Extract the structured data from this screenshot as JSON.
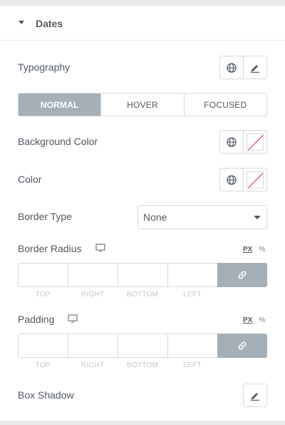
{
  "section": {
    "title": "Dates"
  },
  "typography": {
    "label": "Typography",
    "icons": [
      "globe-icon",
      "pencil-icon"
    ]
  },
  "state_tabs": [
    {
      "label": "NORMAL",
      "active": true
    },
    {
      "label": "HOVER",
      "active": false
    },
    {
      "label": "FOCUSED",
      "active": false
    }
  ],
  "background_color": {
    "label": "Background Color",
    "icons": [
      "globe-icon",
      "empty-color-swatch"
    ]
  },
  "color": {
    "label": "Color",
    "icons": [
      "globe-icon",
      "empty-color-swatch"
    ]
  },
  "border_type": {
    "label": "Border Type",
    "selected": "None"
  },
  "border_radius": {
    "label": "Border Radius",
    "device_icon": "desktop-icon",
    "units": [
      "PX",
      "%"
    ],
    "selected_unit": "PX",
    "sides": [
      "TOP",
      "RIGHT",
      "BOTTOM",
      "LEFT"
    ],
    "values": [
      "",
      "",
      "",
      ""
    ],
    "linked": true
  },
  "padding": {
    "label": "Padding",
    "device_icon": "desktop-icon",
    "units": [
      "PX",
      "%"
    ],
    "selected_unit": "PX",
    "sides": [
      "TOP",
      "RIGHT",
      "BOTTOM",
      "LEFT"
    ],
    "values": [
      "",
      "",
      "",
      ""
    ],
    "linked": true
  },
  "box_shadow": {
    "label": "Box Shadow",
    "icons": [
      "pencil-icon"
    ]
  },
  "colors": {
    "accent_gray": "#a4afb7",
    "text": "#515962",
    "border": "#d5d8dc",
    "no_color_line": "#d72b3f"
  }
}
